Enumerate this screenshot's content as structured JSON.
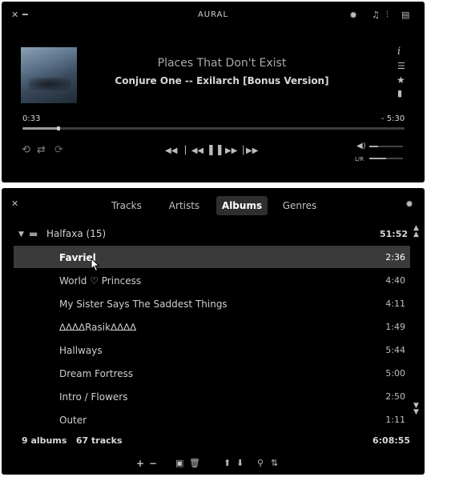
{
  "player": {
    "app_title": "AURAL",
    "song_title": "Places That Don't Exist",
    "artist_album": "Conjure One -- Exilarch [Bonus Version]",
    "elapsed": "0:33",
    "remaining": "- 5:30",
    "progress": 0.095,
    "volume": 0.25,
    "balance": 0.5,
    "balance_label": "L/R",
    "info_label": "i"
  },
  "playlist": {
    "tabs": [
      {
        "label": "Tracks",
        "active": false
      },
      {
        "label": "Artists",
        "active": false
      },
      {
        "label": "Albums",
        "active": true
      },
      {
        "label": "Genres",
        "active": false
      }
    ],
    "group": {
      "name": "Halfaxa (15)",
      "duration": "51:52"
    },
    "tracks": [
      {
        "name": "Favriel",
        "duration": "2:36",
        "selected": true
      },
      {
        "name": "World ♡ Princess",
        "duration": "4:40",
        "selected": false
      },
      {
        "name": "My Sister Says The Saddest Things",
        "duration": "4:11",
        "selected": false
      },
      {
        "name": "∆∆∆∆Rasik∆∆∆∆",
        "duration": "1:49",
        "selected": false
      },
      {
        "name": "Hallways",
        "duration": "5:44",
        "selected": false
      },
      {
        "name": "Dream Fortress",
        "duration": "5:00",
        "selected": false
      },
      {
        "name": "Intro / Flowers",
        "duration": "2:50",
        "selected": false
      },
      {
        "name": "Outer",
        "duration": "1:11",
        "selected": false
      }
    ],
    "summary": {
      "counts": "9 albums   67 tracks",
      "total_duration": "6:08:55"
    }
  },
  "colors": {
    "background": "#000000",
    "selected_row": "#3a3a3a",
    "text": "#c8c8c8"
  }
}
